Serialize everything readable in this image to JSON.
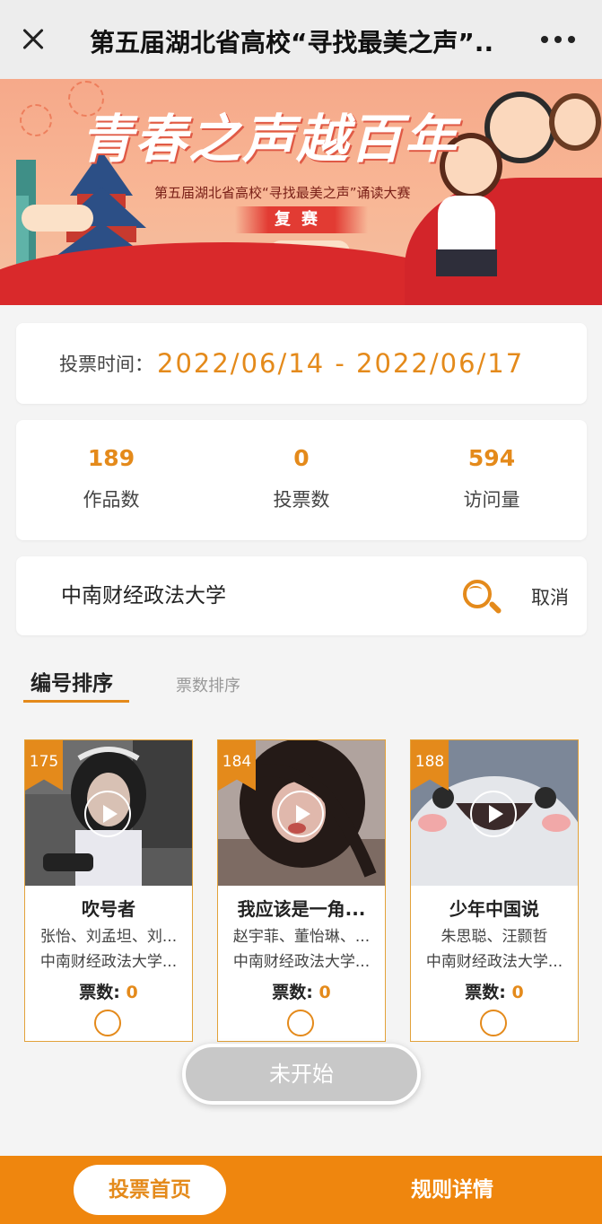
{
  "header": {
    "title": "第五届湖北省高校“寻找最美之声”..."
  },
  "banner": {
    "slogan": "青春之声越百年",
    "subtitle": "第五届湖北省高校“寻找最美之声”诵读大赛",
    "stage": "复赛"
  },
  "voting": {
    "label": "投票时间：",
    "range": "2022/06/14 - 2022/06/17"
  },
  "stats": [
    {
      "value": "189",
      "label": "作品数"
    },
    {
      "value": "0",
      "label": "投票数"
    },
    {
      "value": "594",
      "label": "访问量"
    }
  ],
  "search": {
    "value": "中南财经政法大学",
    "cancel_label": "取消"
  },
  "sort_tabs": [
    {
      "label": "编号排序",
      "active": true
    },
    {
      "label": "票数排序",
      "active": false
    }
  ],
  "entries": [
    {
      "id": "175",
      "title": "吹号者",
      "authors": "张怡、刘孟坦、刘...",
      "school": "中南财经政法大学...",
      "votes_label": "票数:",
      "votes": "0"
    },
    {
      "id": "184",
      "title": "我应该是一角...",
      "authors": "赵宇菲、董怡琳、...",
      "school": "中南财经政法大学...",
      "votes_label": "票数:",
      "votes": "0"
    },
    {
      "id": "188",
      "title": "少年中国说",
      "authors": "朱思聪、汪颢哲",
      "school": "中南财经政法大学...",
      "votes_label": "票数:",
      "votes": "0"
    }
  ],
  "status_button": "未开始",
  "bottom_nav": {
    "home": "投票首页",
    "rules": "规则详情"
  },
  "colors": {
    "accent": "#e48a1b",
    "bottom_bar": "#ef860e",
    "disabled": "#c8c8c8"
  }
}
